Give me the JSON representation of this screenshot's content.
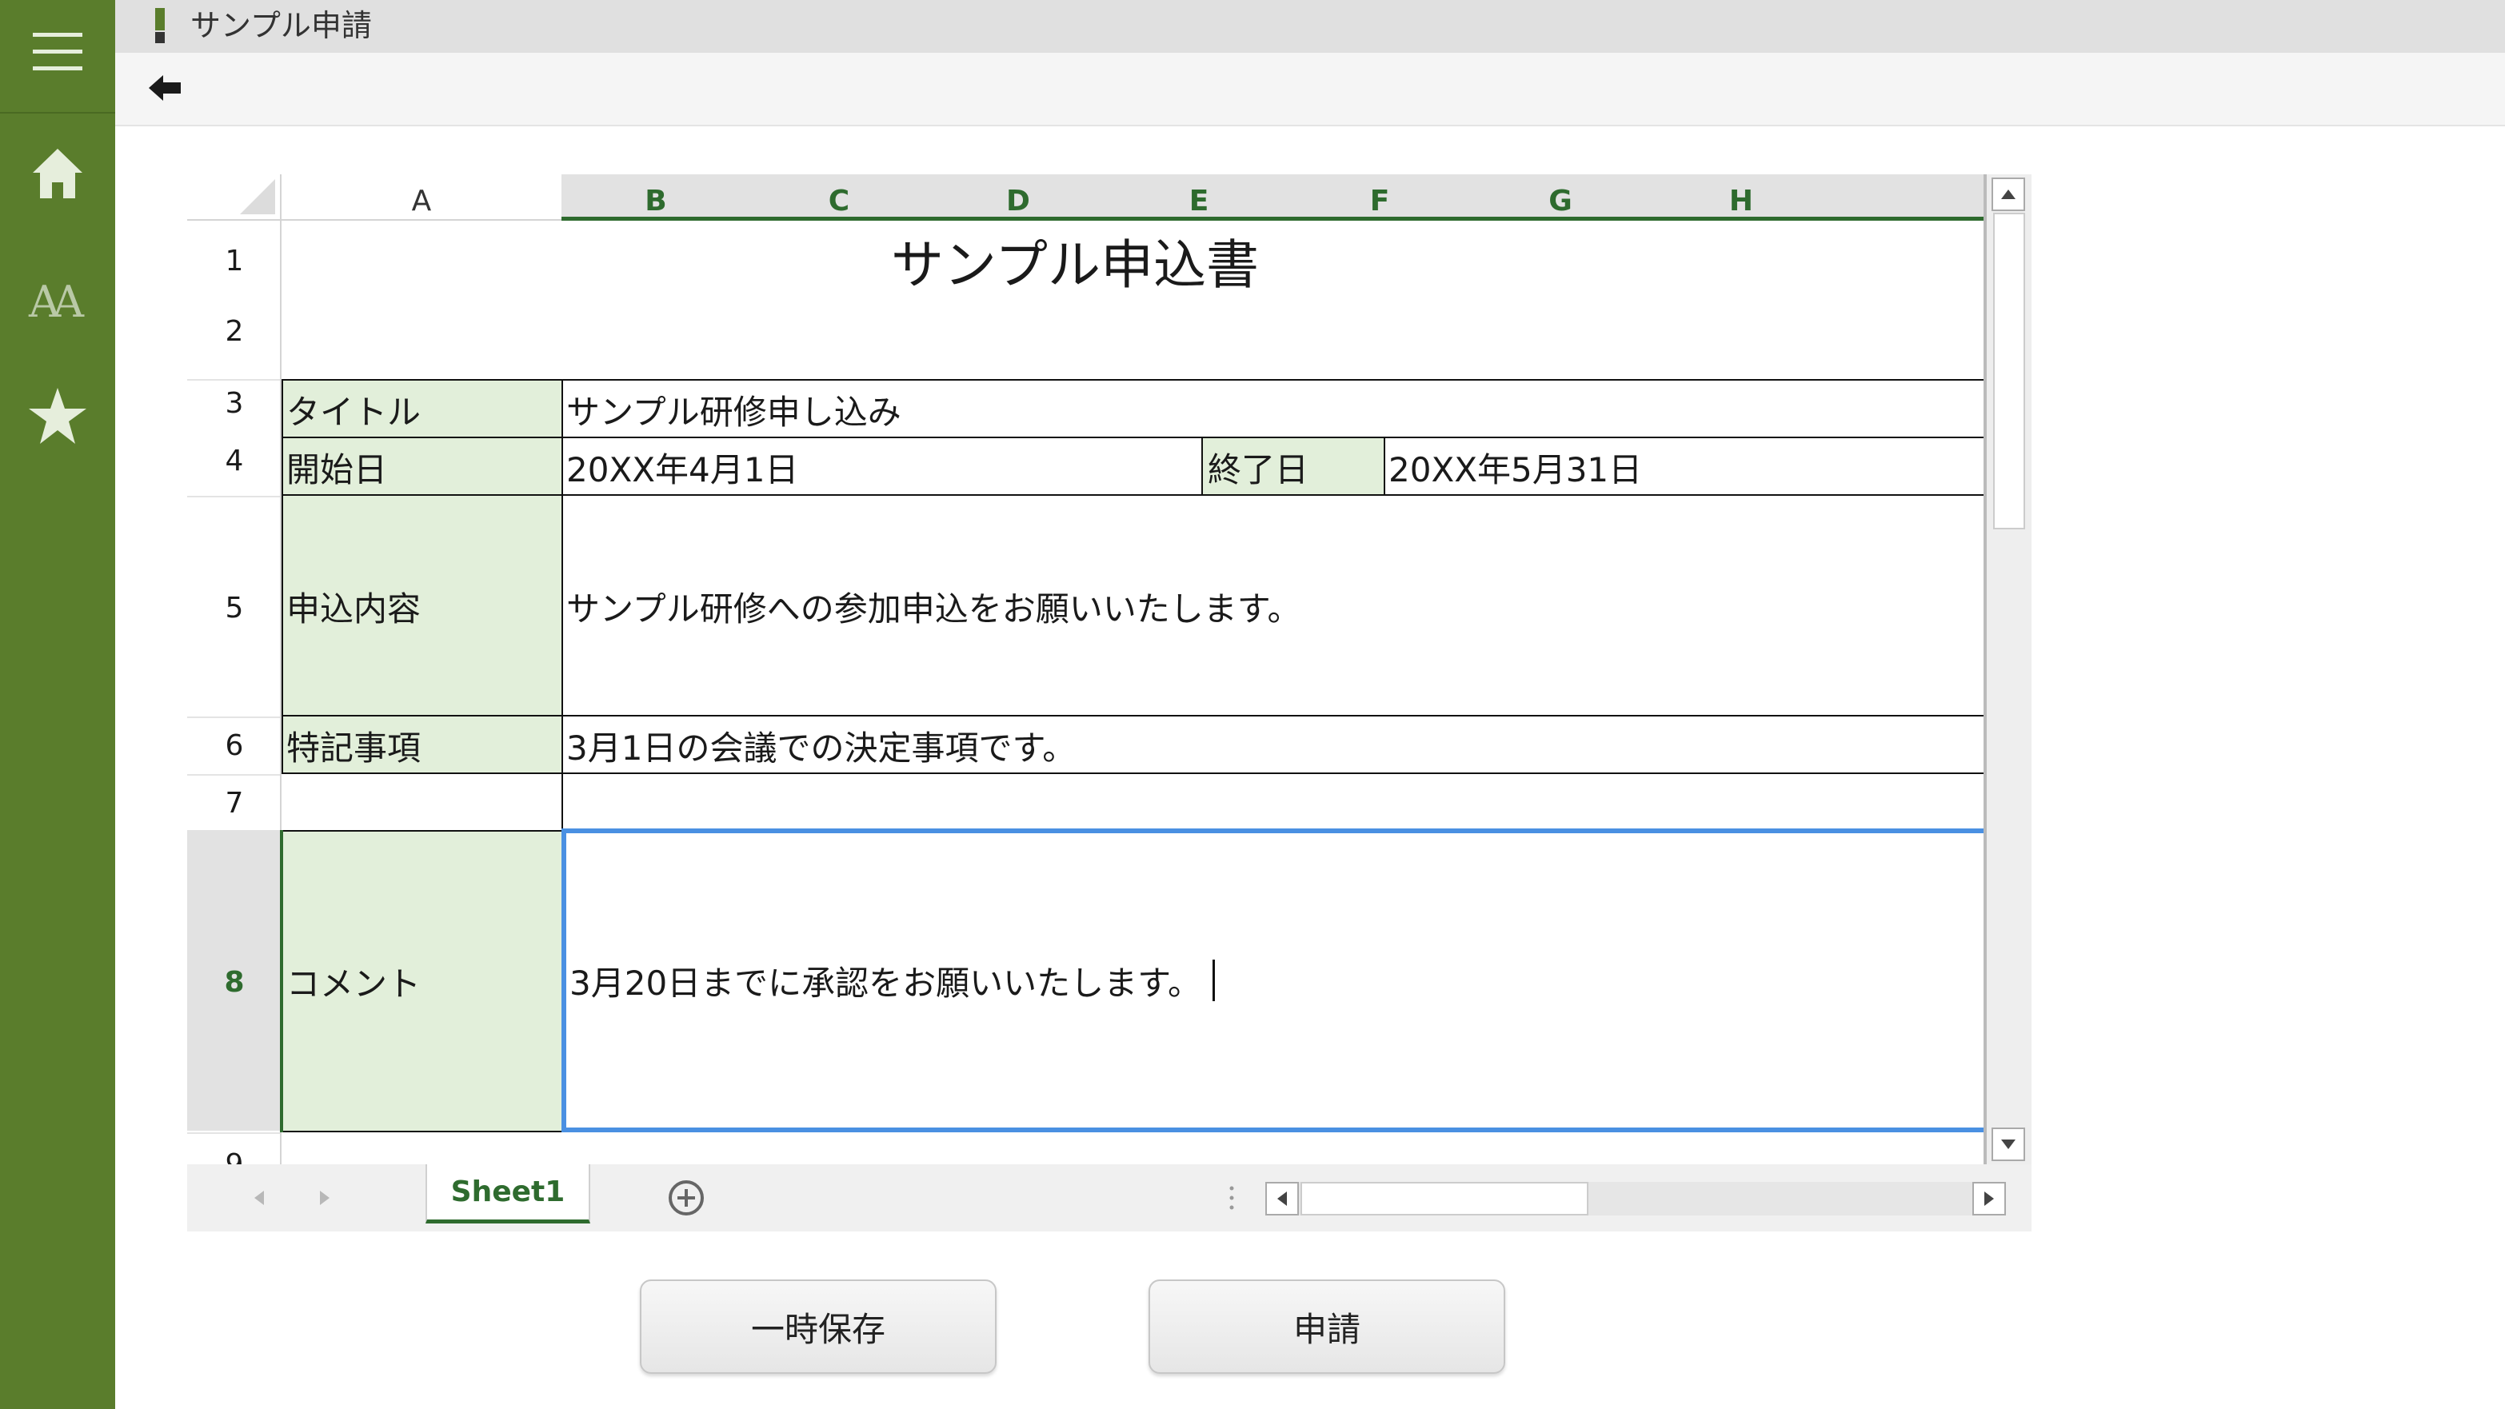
{
  "app": {
    "title": "サンプル申請"
  },
  "sheet": {
    "columns": [
      "A",
      "B",
      "C",
      "D",
      "E",
      "F",
      "G",
      "H"
    ],
    "rows": [
      "1",
      "2",
      "3",
      "4",
      "5",
      "6",
      "7",
      "8",
      "9"
    ],
    "form_title": "サンプル申込書",
    "title_label": "タイトル",
    "title_value": "サンプル研修申し込み",
    "start_label": "開始日",
    "start_value": "20XX年4月1日",
    "end_label": "終了日",
    "end_value": "20XX年5月31日",
    "content_label": "申込内容",
    "content_value": "サンプル研修への参加申込をお願いいたします。",
    "notes_label": "特記事項",
    "notes_value": "3月1日の会議での決定事項です。",
    "comment_label": "コメント",
    "comment_value": "3月20日までに承認をお願いいたします。"
  },
  "tabs": {
    "active": "Sheet1"
  },
  "buttons": {
    "save": "一時保存",
    "apply": "申請"
  },
  "colors": {
    "accent": "#5a7d2c",
    "label_fill": "#e2efda",
    "selection": "#4a90e2",
    "header_active": "#2e6b2e"
  }
}
